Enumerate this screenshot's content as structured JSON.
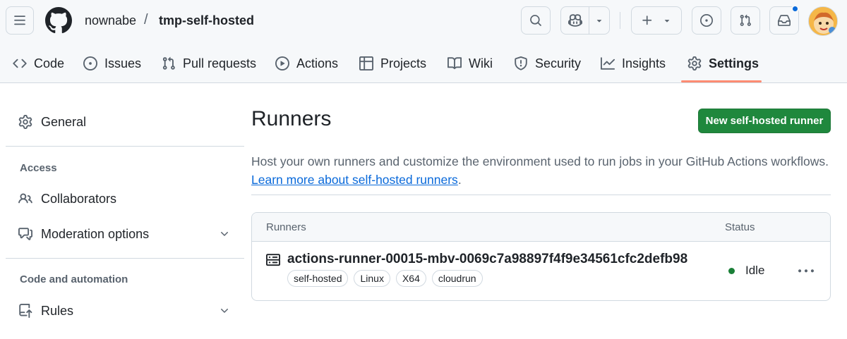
{
  "header": {
    "owner": "nownabe",
    "separator": "/",
    "repo": "tmp-self-hosted",
    "icons": [
      "three-bars-icon",
      "github-mark-icon",
      "search-icon",
      "copilot-icon",
      "triangle-down-icon",
      "plus-icon",
      "issue-opened-icon",
      "git-pull-request-icon",
      "inbox-icon"
    ]
  },
  "tabs": [
    {
      "label": "Code",
      "icon": "code-icon"
    },
    {
      "label": "Issues",
      "icon": "issue-opened-icon"
    },
    {
      "label": "Pull requests",
      "icon": "git-pull-request-icon"
    },
    {
      "label": "Actions",
      "icon": "play-icon"
    },
    {
      "label": "Projects",
      "icon": "table-icon"
    },
    {
      "label": "Wiki",
      "icon": "book-icon"
    },
    {
      "label": "Security",
      "icon": "shield-icon"
    },
    {
      "label": "Insights",
      "icon": "graph-icon"
    },
    {
      "label": "Settings",
      "icon": "gear-icon",
      "active": true
    }
  ],
  "sidebar": {
    "general": "General",
    "access_heading": "Access",
    "collaborators": "Collaborators",
    "moderation": "Moderation options",
    "code_automation_heading": "Code and automation",
    "rules": "Rules"
  },
  "main": {
    "title": "Runners",
    "new_runner_button": "New self-hosted runner",
    "description": "Host your own runners and customize the environment used to run jobs in your GitHub Actions workflows.",
    "learn_more_link": "Learn more about self-hosted runners",
    "learn_more_suffix": "."
  },
  "runners_table": {
    "col_runners": "Runners",
    "col_status": "Status",
    "rows": [
      {
        "name": "actions-runner-00015-mbv-0069c7a98897f4f9e34561cfc2defb98",
        "labels": [
          "self-hosted",
          "Linux",
          "X64",
          "cloudrun"
        ],
        "status": "Idle"
      }
    ]
  },
  "colors": {
    "accent": "#0969da",
    "primary_button": "#1f883d",
    "status_idle": "#1a7f37",
    "tab_underline": "#fd8c73",
    "header_bg": "#f6f8fa"
  }
}
